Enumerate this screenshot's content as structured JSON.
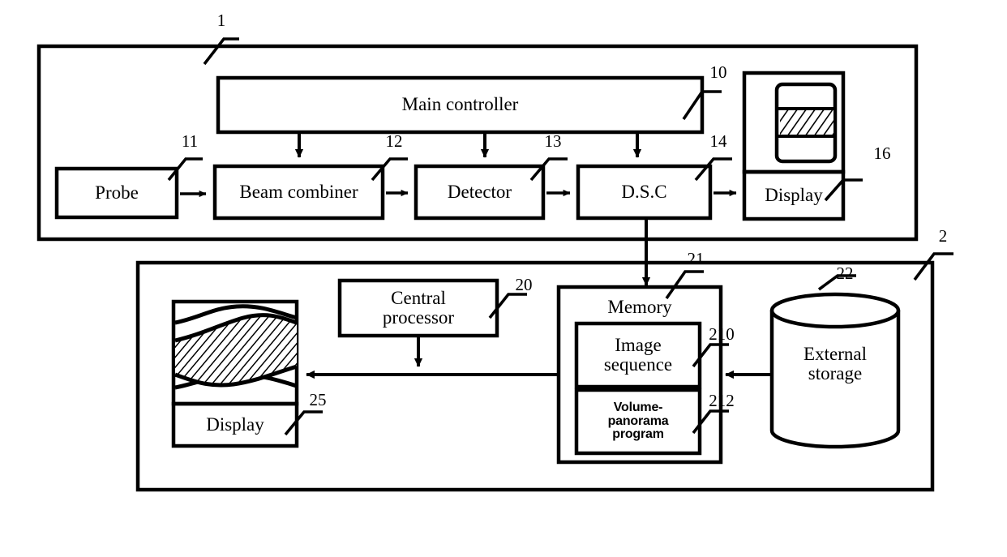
{
  "figure": {
    "title": "Ultrasound diagnostic system block diagram",
    "ink_color": "#000000",
    "background_color": "#ffffff"
  },
  "system_1": {
    "ref": "1",
    "blocks": {
      "main_controller": {
        "label": "Main controller",
        "ref": "10"
      },
      "probe": {
        "label": "Probe",
        "ref": "11"
      },
      "beam_combiner": {
        "label": "Beam combiner",
        "ref": "12"
      },
      "detector": {
        "label": "Detector",
        "ref": "13"
      },
      "dsc": {
        "label": "D.S.C",
        "ref": "14"
      },
      "display": {
        "label": "Display",
        "ref": "16",
        "screen_icon": "ultrasound-frame-icon"
      }
    }
  },
  "system_2": {
    "ref": "2",
    "blocks": {
      "central_processor": {
        "label": "Central\nprocessor",
        "ref": "20"
      },
      "memory": {
        "label": "Memory",
        "ref": "21"
      },
      "image_sequence": {
        "label": "Image\nsequence",
        "ref": "210"
      },
      "volume_panorama_program": {
        "label": "Volume-\npanorama\nprogram",
        "ref": "212"
      },
      "external_storage": {
        "label": "External\nstorage",
        "ref": "22",
        "shape": "cylinder-icon"
      },
      "display": {
        "label": "Display",
        "ref": "25",
        "screen_icon": "volume-panorama-image-icon"
      }
    }
  }
}
